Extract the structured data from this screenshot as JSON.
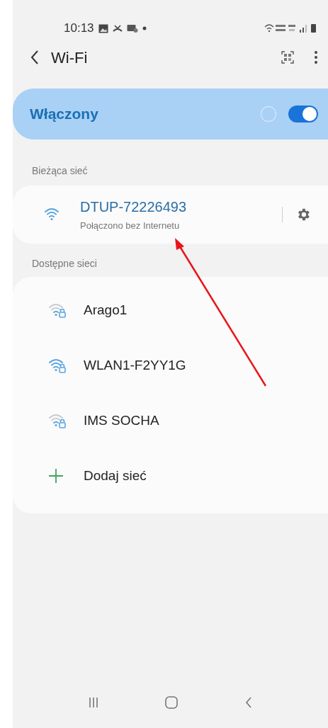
{
  "status_bar": {
    "time": "10:13"
  },
  "header": {
    "title": "Wi-Fi"
  },
  "master_switch": {
    "label": "Włączony",
    "on": true
  },
  "current_section": {
    "title": "Bieżąca sieć",
    "network": {
      "name": "DTUP-72226493",
      "status": "Połączono bez Internetu"
    }
  },
  "available_section": {
    "title": "Dostępne sieci",
    "items": [
      {
        "kind": "weak",
        "label": "Arago1"
      },
      {
        "kind": "strong",
        "label": "WLAN1-F2YY1G"
      },
      {
        "kind": "weak",
        "label": "IMS SOCHA"
      },
      {
        "kind": "add",
        "label": "Dodaj sieć"
      }
    ]
  }
}
